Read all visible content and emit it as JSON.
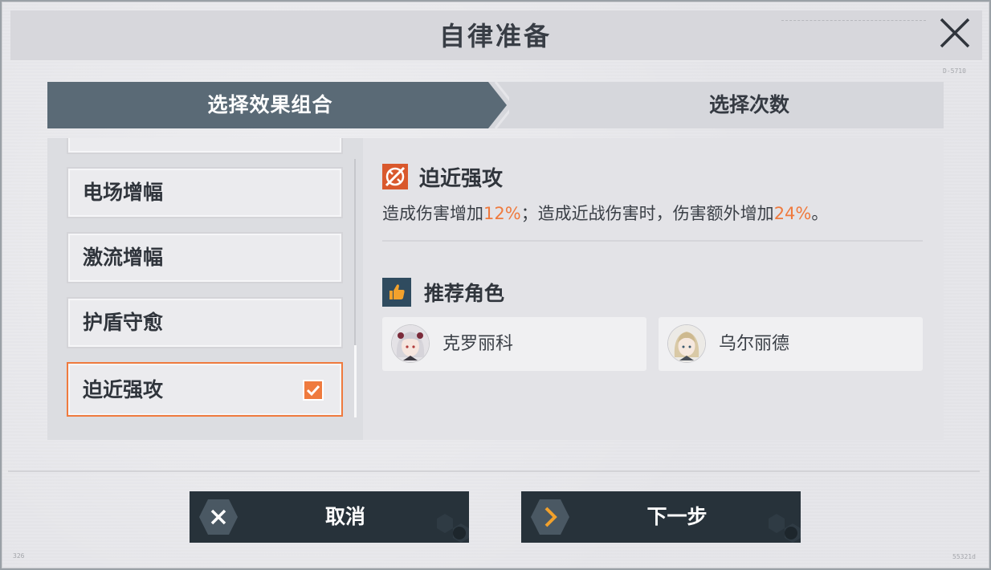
{
  "header": {
    "title": "自律准备"
  },
  "codes": {
    "top_right": "D-5710",
    "bottom_left": "326",
    "bottom_right": "55321d"
  },
  "steps": [
    {
      "label": "选择效果组合",
      "active": true
    },
    {
      "label": "选择次数",
      "active": false
    }
  ],
  "effect_list": {
    "items": [
      {
        "label": ""
      },
      {
        "label": "电场增幅"
      },
      {
        "label": "激流增幅"
      },
      {
        "label": "护盾守愈"
      },
      {
        "label": "迫近强攻",
        "selected": true,
        "checked": true
      }
    ]
  },
  "detail": {
    "title": "迫近强攻",
    "desc_part1": "造成伤害增加",
    "desc_value1": "12%",
    "desc_part2": "；造成近战伤害时，伤害额外增加",
    "desc_value2": "24%",
    "desc_part3": "。",
    "recommend_title": "推荐角色",
    "characters": [
      {
        "name": "克罗丽科"
      },
      {
        "name": "乌尔丽德"
      }
    ]
  },
  "footer": {
    "cancel_label": "取消",
    "next_label": "下一步"
  },
  "colors": {
    "accent": "#ef7a3e",
    "step_active": "#5a6a76",
    "button_bg": "#27323a",
    "next_chevron": "#f2a12c"
  },
  "icons": {
    "close": "close-icon",
    "effect": "crossed-swords-icon",
    "recommend": "thumbs-up-icon",
    "checkbox": "checkmark-icon",
    "cancel": "x-icon",
    "next": "chevron-right-icon"
  }
}
